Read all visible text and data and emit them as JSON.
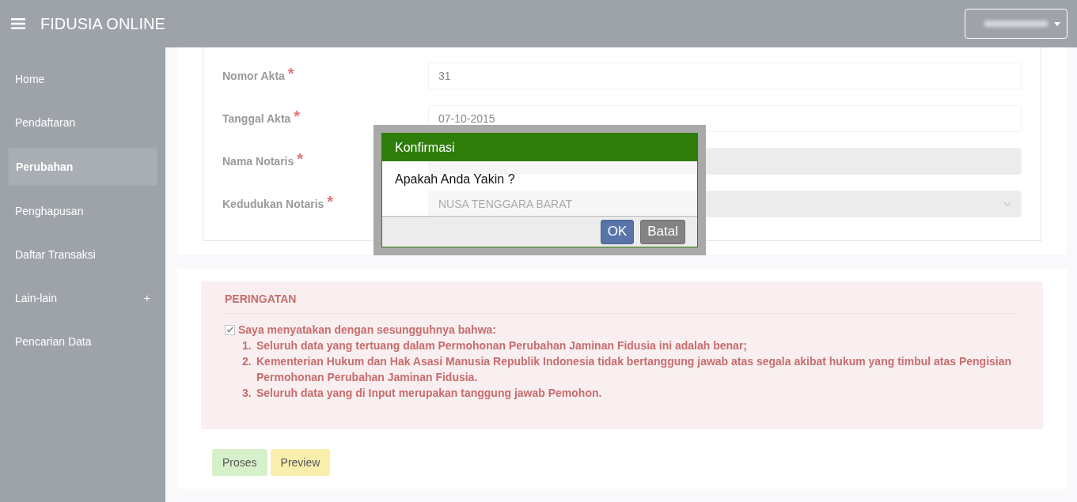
{
  "header": {
    "title": "FIDUSIA ONLINE"
  },
  "sidebar": {
    "items": [
      {
        "label": "Home",
        "selected": false
      },
      {
        "label": "Pendaftaran",
        "selected": false
      },
      {
        "label": "Perubahan",
        "selected": true
      },
      {
        "label": "Penghapusan",
        "selected": false
      },
      {
        "label": "Daftar Transaksi",
        "selected": false
      },
      {
        "label": "Lain-lain",
        "selected": false,
        "expander": "+"
      },
      {
        "label": "Pencarian Data",
        "selected": false
      }
    ]
  },
  "form": {
    "fields": [
      {
        "label": "Nomor Akta",
        "required": true,
        "required_mark": "*",
        "kind": "text",
        "value": "31",
        "disabled": false
      },
      {
        "label": "Tanggal Akta",
        "required": true,
        "required_mark": "*",
        "kind": "text",
        "value": "07-10-2015",
        "disabled": false
      },
      {
        "label": "Nama Notaris",
        "required": true,
        "required_mark": "*",
        "kind": "text",
        "disabled": true
      },
      {
        "label": "Kedudukan Notaris",
        "required": true,
        "required_mark": "*",
        "kind": "select",
        "value": "NUSA TENGGARA BARAT",
        "disabled": true
      }
    ]
  },
  "warning": {
    "title": "PERINGATAN",
    "checked": true,
    "statement": "Saya menyatakan dengan sesungguhnya bahwa:",
    "points": [
      {
        "number": "1.",
        "text": "Seluruh data yang tertuang dalam Permohonan Perubahan Jaminan Fidusia ini adalah benar;"
      },
      {
        "number": "2.",
        "text": "Kementerian Hukum dan Hak Asasi Manusia Republik Indonesia tidak bertanggung jawab atas segala akibat hukum yang timbul atas Pengisian Permohonan Perubahan Jaminan Fidusia."
      },
      {
        "number": "3.",
        "text": "Seluruh data yang di Input merupakan tanggung jawab Pemohon."
      }
    ]
  },
  "actions": [
    {
      "label": "Proses",
      "kind": "success"
    },
    {
      "label": "Preview",
      "kind": "warning"
    }
  ],
  "dialog": {
    "title": "Konfirmasi",
    "message": "Apakah Anda Yakin ?",
    "buttons": [
      {
        "label": "OK",
        "kind": "primary"
      },
      {
        "label": "Batal",
        "kind": "default"
      }
    ]
  }
}
